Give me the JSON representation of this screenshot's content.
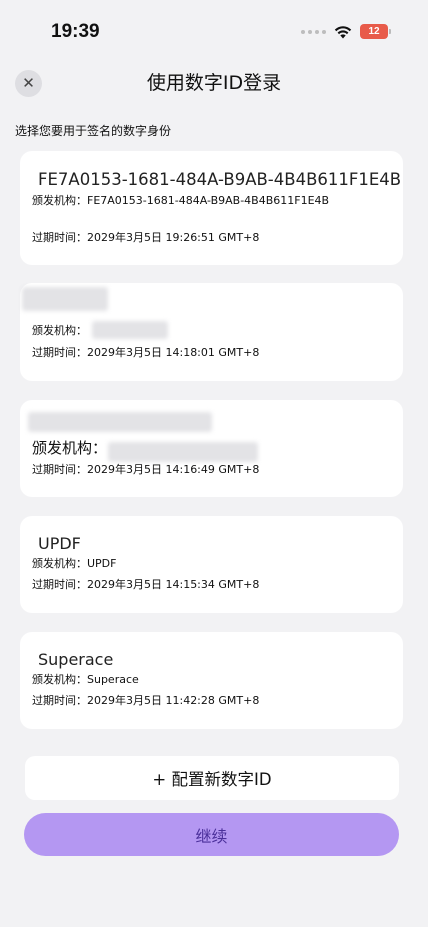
{
  "status_bar": {
    "time": "19:39",
    "battery": "12"
  },
  "header": {
    "close_icon": "✕",
    "title": "使用数字ID登录"
  },
  "subtitle": "选择您要用于签名的数字身份",
  "ids": [
    {
      "name": "FE7A0153-1681-484A-B9AB-4B4B611F1E4B",
      "issuer": "颁发机构：FE7A0153-1681-484A-B9AB-4B4B611F1E4B",
      "expires": "过期时间：2029年3月5日 19:26:51 GMT+8"
    },
    {
      "name": "",
      "issuer": "颁发机构：",
      "expires": "过期时间：2029年3月5日 14:18:01 GMT+8"
    },
    {
      "name": "",
      "issuer": "颁发机构：",
      "expires": "过期时间：2029年3月5日 14:16:49 GMT+8"
    },
    {
      "name": "UPDF",
      "issuer": "颁发机构：UPDF",
      "expires": "过期时间：2029年3月5日 14:15:34 GMT+8"
    },
    {
      "name": "Superace",
      "issuer": "颁发机构：Superace",
      "expires": "过期时间：2029年3月5日 11:42:28 GMT+8"
    }
  ],
  "buttons": {
    "add": "+ 配置新数字ID",
    "continue": "继续"
  },
  "colors": {
    "background": "#f2f2f4",
    "accent": "#b497f2",
    "accent_text": "#4a2f9a",
    "battery": "#e85b4a"
  }
}
